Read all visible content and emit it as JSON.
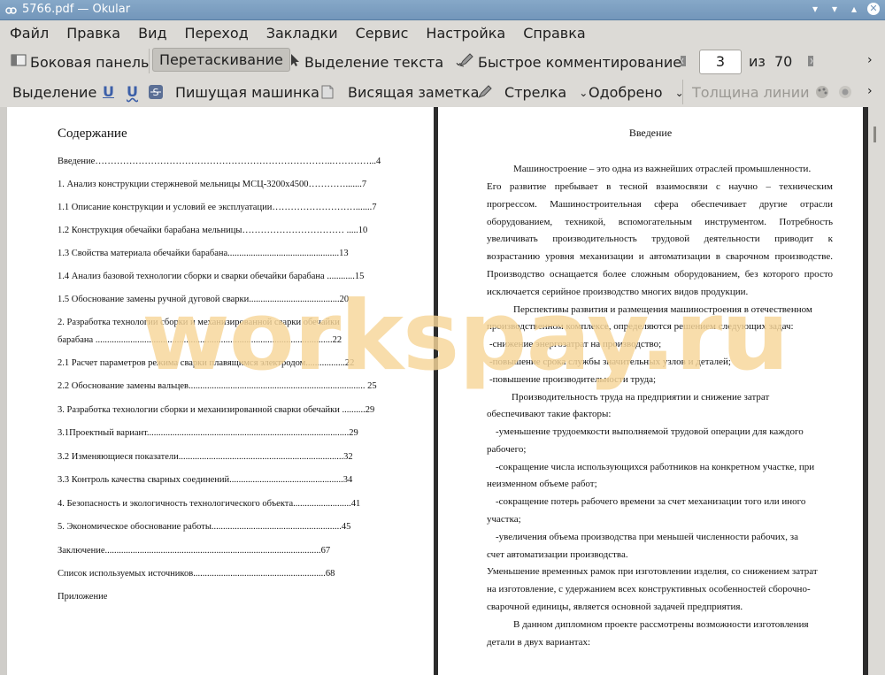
{
  "window": {
    "title": "5766.pdf  — Okular"
  },
  "menu": [
    "Файл",
    "Правка",
    "Вид",
    "Переход",
    "Закладки",
    "Сервис",
    "Настройка",
    "Справка"
  ],
  "toolbar1": {
    "side_panel": "Боковая панель",
    "drag": "Перетаскивание",
    "text_select": "Выделение текста",
    "quick_comment": "Быстрое комментирование",
    "page_current": "3",
    "page_of": "из",
    "page_total": "70"
  },
  "toolbar2": {
    "highlight": "Выделение",
    "underline": "U",
    "squiggle": "U",
    "typewriter": "Пишущая машинка",
    "sticky_note": "Висящая заметка",
    "arrow": "Стрелка",
    "stamp": "Одобрено",
    "line_width": "Толщина линии"
  },
  "left_page": {
    "title": "Содержание",
    "toc": [
      "Введение…………………………………………………………………..…………...4",
      "1. Анализ конструкции стержневой мельницы МСЦ-3200х4500………….......7",
      "1.1 Описание конструкции и условий ее эксплуатации……………………….......7",
      "1.2 Конструкция обечайки барабана  мельницы……………………………  .....10",
      "1.3 Свойства материала обечайки барабана................................................13",
      "1.4 Анализ базовой технологии сборки и сварки обечайки барабана ............15",
      "1.5 Обоснование замены ручной дуговой сварки.......................................20",
      "2.  Разработка  технологии  сборки  и  механизированной  сварки  обечайки",
      "барабана ......................................................................................................22",
      "2.1 Расчет параметров режима сварки плавящимся электродом.................22",
      "2.2 Обоснование замены вальцев............................................................................ 25",
      "3. Разработка технологии сборки и механизированной сварки обечайки ..........29",
      "3.1Проектный вариант.......................................................................................29",
      "3.2 Изменяющиеся показатели.......................................................................32",
      "3.3 Контроль качества сварных соединений.................................................34",
      "4. Безопасность и экологичность технологического объекта.........................41",
      " 5. Экономическое обоснование работы........................................................45",
      "Заключение.............................................................................................67",
      "Список используемых источников.........................................................68",
      "Приложение"
    ]
  },
  "right_page": {
    "title": "Введение",
    "lines": [
      "Машиностроение – это одна из важнейших отраслей промышленности.",
      "Его развитие пребывает в тесной взаимосвязи с научно – техническим",
      "прогрессом. Машиностроительная сфера обеспечивает другие отрасли",
      "оборудованием, техникой, вспомогательным инструментом. Потребность",
      "увеличивать производительность трудовой деятельности приводит к",
      "возрастанию уровня механизации и автоматизации в сварочном производстве.",
      "Производство оснащается более сложным оборудованием, без которого просто",
      "исключается серийное производство многих видов продукции.",
      "Перспективы развития и размещения машиностроения в отечественном",
      "производственном комплексе, определяются решением следующих задач:",
      "-снижение энергозатрат на производство;",
      "-повышение срока службы значительных узлов и деталей;",
      "-повышение производительности труда;",
      "Производительность труда на предприятии и снижение затрат",
      "обеспечивают такие факторы:",
      "-уменьшение трудоемкости выполняемой трудовой операции для каждого",
      "рабочего;",
      "-сокращение числа использующихся работников на конкретном участке, при",
      "неизменном объеме работ;",
      "-сокращение потерь рабочего времени за счет механизации того или иного",
      "участка;",
      "-увеличения объема производства при меньшей  численности рабочих, за",
      "счет автоматизации производства.",
      "Уменьшение временных рамок при изготовлении изделия, со снижением затрат",
      "на изготовление, с удержанием всех конструктивных особенностей сборочно-",
      "сварочной единицы, является основной задачей предприятия.",
      "В данном дипломном проекте рассмотрены возможности изготовления",
      "детали в двух вариантах:"
    ]
  },
  "watermark": "workspay.ru",
  "colors": {
    "titlebar": "#7ea1c4",
    "toolbar": "#dcdad6",
    "watermark": "#f6d698"
  }
}
